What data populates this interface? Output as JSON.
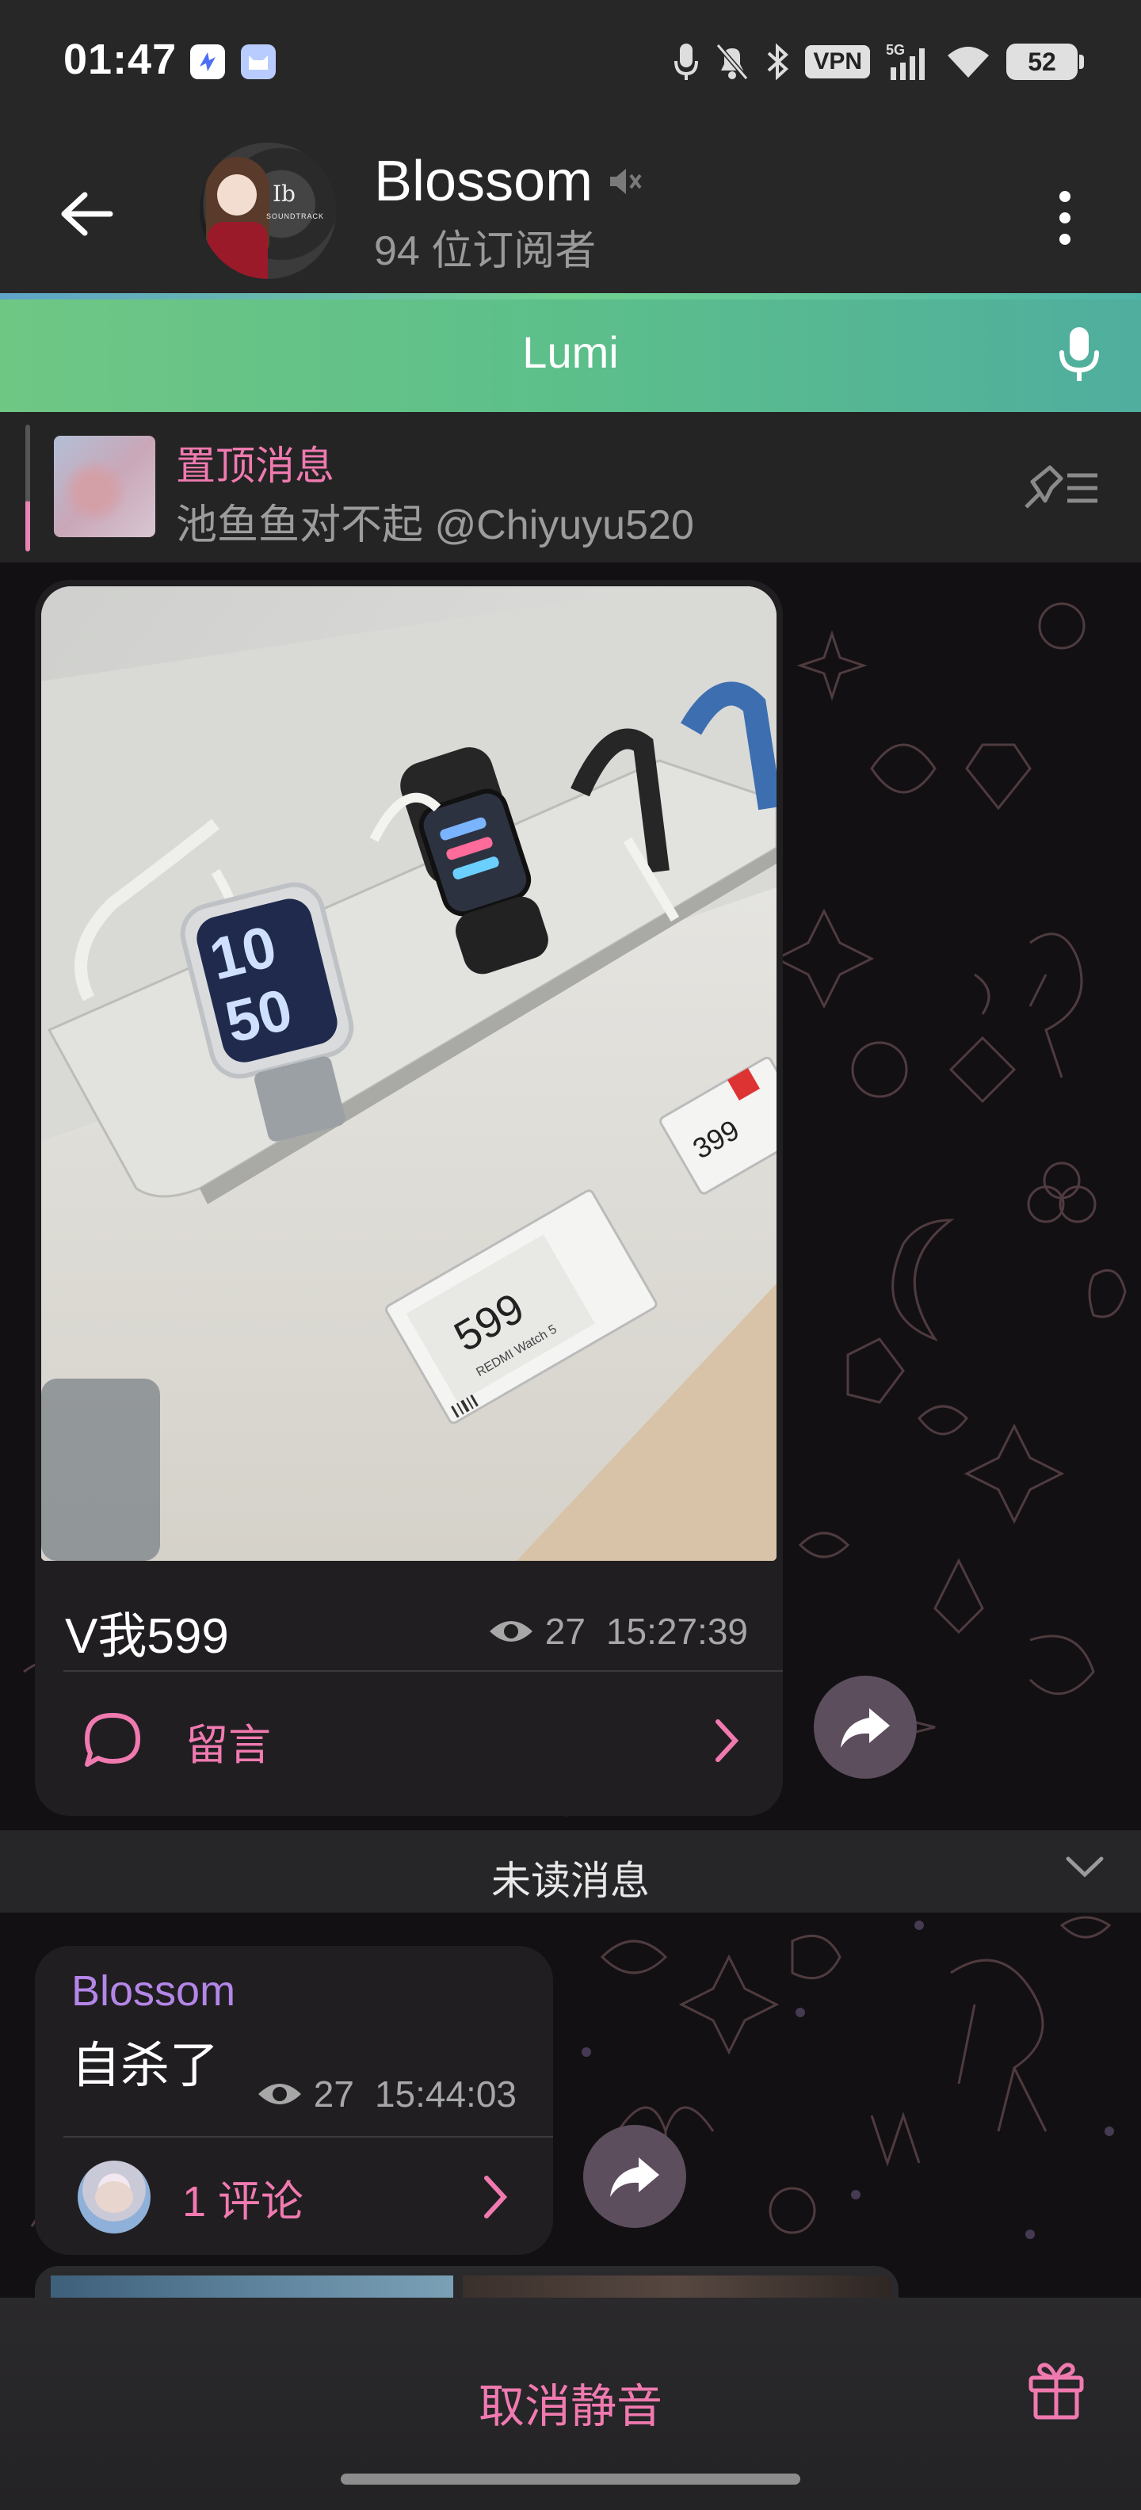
{
  "status_bar": {
    "time": "01:47",
    "vpn": "VPN",
    "network": "5G",
    "battery": "52",
    "icons": [
      "mic-icon",
      "bell-muted-icon",
      "bluetooth-icon",
      "signal-icon",
      "wifi-icon"
    ]
  },
  "header": {
    "channel_name": "Blossom",
    "subscribers": "94 位订阅者",
    "avatar_text": "Ib",
    "avatar_subtext": "SOUNDTRACK"
  },
  "lumi_bar": {
    "title": "Lumi"
  },
  "pinned": {
    "title": "置顶消息",
    "text": "池鱼鱼对不起 @Chiyuyu520"
  },
  "messages": [
    {
      "caption": "V我599",
      "views": "27",
      "time": "15:27:39",
      "comment_label": "留言",
      "photo_labels": {
        "watch_time_top": "10",
        "watch_time_bottom": "50",
        "price_tag_1": "599",
        "price_tag_1_sub": "REDMI Watch 5",
        "price_tag_2": "399"
      }
    },
    {
      "sender": "Blossom",
      "text": "自杀了",
      "views": "27",
      "time": "15:44:03",
      "comment_label": "1 评论"
    }
  ],
  "unread_label": "未读消息",
  "bottom_bar": {
    "unmute_label": "取消静音"
  },
  "colors": {
    "accent_pink": "#f07ab0",
    "sender_purple": "#b486e8",
    "lumi_green": "#5cbf8a"
  }
}
